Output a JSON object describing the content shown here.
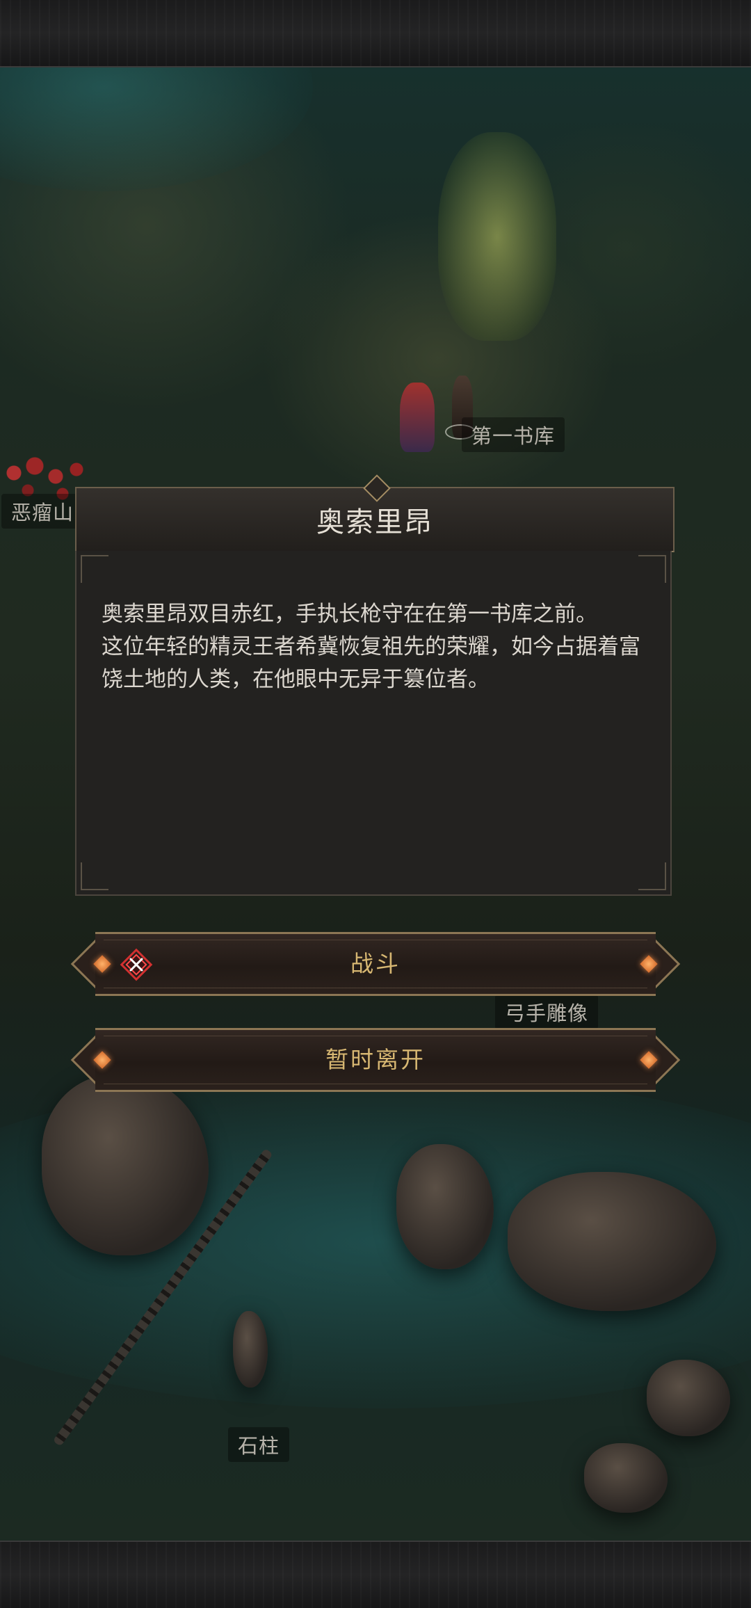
{
  "map": {
    "labels": {
      "library": "第一书库",
      "mountain": "恶瘤山",
      "statue": "弓手雕像",
      "pillar": "石柱"
    }
  },
  "dialog": {
    "title": "奥索里昂",
    "paragraphs": [
      "奥索里昂双目赤红，手执长枪守在在第一书库之前。",
      "这位年轻的精灵王者希冀恢复祖先的荣耀，如今占据着富饶土地的人类，在他眼中无异于篡位者。"
    ]
  },
  "buttons": {
    "fight": {
      "label": "战斗",
      "icon": "crossed-swords-icon"
    },
    "leave": {
      "label": "暂时离开"
    }
  },
  "colors": {
    "button_text": "#d7b772",
    "gem": "#e07a35",
    "frame_gold": "#8c7654",
    "battle_icon": "#d23030"
  }
}
